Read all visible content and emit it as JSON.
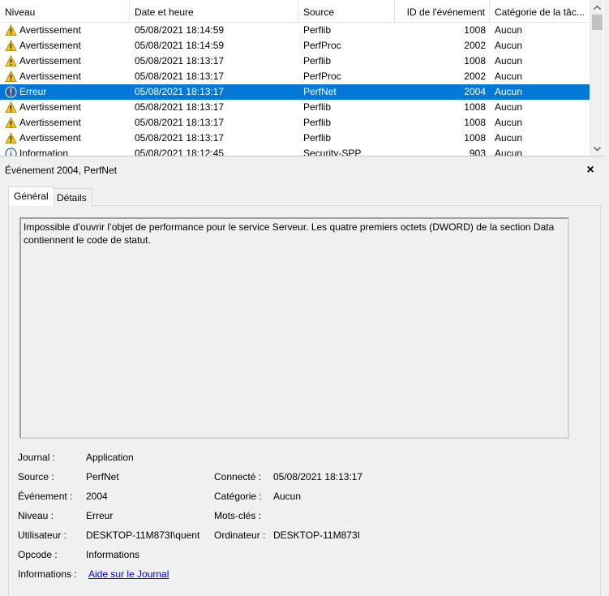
{
  "columns": {
    "level": "Niveau",
    "date": "Date et heure",
    "source": "Source",
    "id": "ID de l'événement",
    "category": "Catégorie de la tâc..."
  },
  "events": [
    {
      "level": "Avertissement",
      "icon": "warning-icon",
      "date": "05/08/2021 18:14:59",
      "source": "Perflib",
      "id": "1008",
      "category": "Aucun"
    },
    {
      "level": "Avertissement",
      "icon": "warning-icon",
      "date": "05/08/2021 18:14:59",
      "source": "PerfProc",
      "id": "2002",
      "category": "Aucun"
    },
    {
      "level": "Avertissement",
      "icon": "warning-icon",
      "date": "05/08/2021 18:13:17",
      "source": "Perflib",
      "id": "1008",
      "category": "Aucun"
    },
    {
      "level": "Avertissement",
      "icon": "warning-icon",
      "date": "05/08/2021 18:13:17",
      "source": "PerfProc",
      "id": "2002",
      "category": "Aucun"
    },
    {
      "level": "Erreur",
      "icon": "error-icon",
      "date": "05/08/2021 18:13:17",
      "source": "PerfNet",
      "id": "2004",
      "category": "Aucun",
      "selected": true
    },
    {
      "level": "Avertissement",
      "icon": "warning-icon",
      "date": "05/08/2021 18:13:17",
      "source": "Perflib",
      "id": "1008",
      "category": "Aucun"
    },
    {
      "level": "Avertissement",
      "icon": "warning-icon",
      "date": "05/08/2021 18:13:17",
      "source": "Perflib",
      "id": "1008",
      "category": "Aucun"
    },
    {
      "level": "Avertissement",
      "icon": "warning-icon",
      "date": "05/08/2021 18:13:17",
      "source": "Perflib",
      "id": "1008",
      "category": "Aucun"
    },
    {
      "level": "Information",
      "icon": "info-icon",
      "date": "05/08/2021 18:12:45",
      "source": "Security-SPP",
      "id": "903",
      "category": "Aucun"
    }
  ],
  "detail": {
    "title": "Événement 2004, PerfNet",
    "close": "×",
    "tabs": {
      "general": "Général",
      "details": "Détails"
    },
    "description": "Impossible d’ouvrir l’objet de performance pour le service Serveur. Les quatre premiers octets (DWORD) de la section Data contiennent le code de statut.",
    "fields": {
      "journal_label": "Journal :",
      "journal_value": "Application",
      "source_label": "Source :",
      "source_value": "PerfNet",
      "connected_label": "Connecté :",
      "connected_value": "05/08/2021 18:13:17",
      "event_label": "Événement :",
      "event_value": "2004",
      "category_label": "Catégorie :",
      "category_value": "Aucun",
      "level_label": "Niveau :",
      "level_value": "Erreur",
      "keywords_label": "Mots-clés :",
      "user_label": "Utilisateur :",
      "user_value": "DESKTOP-11M873I\\quent",
      "computer_label": "Ordinateur :",
      "computer_value": "DESKTOP-11M873I",
      "opcode_label": "Opcode :",
      "opcode_value": "Informations",
      "info_label": "Informations :",
      "info_link": "Aide sur le Journal"
    }
  },
  "colors": {
    "selection": "#0078d7",
    "warning": "#f5c518",
    "error": "#2b5797",
    "link": "#0000ee"
  }
}
